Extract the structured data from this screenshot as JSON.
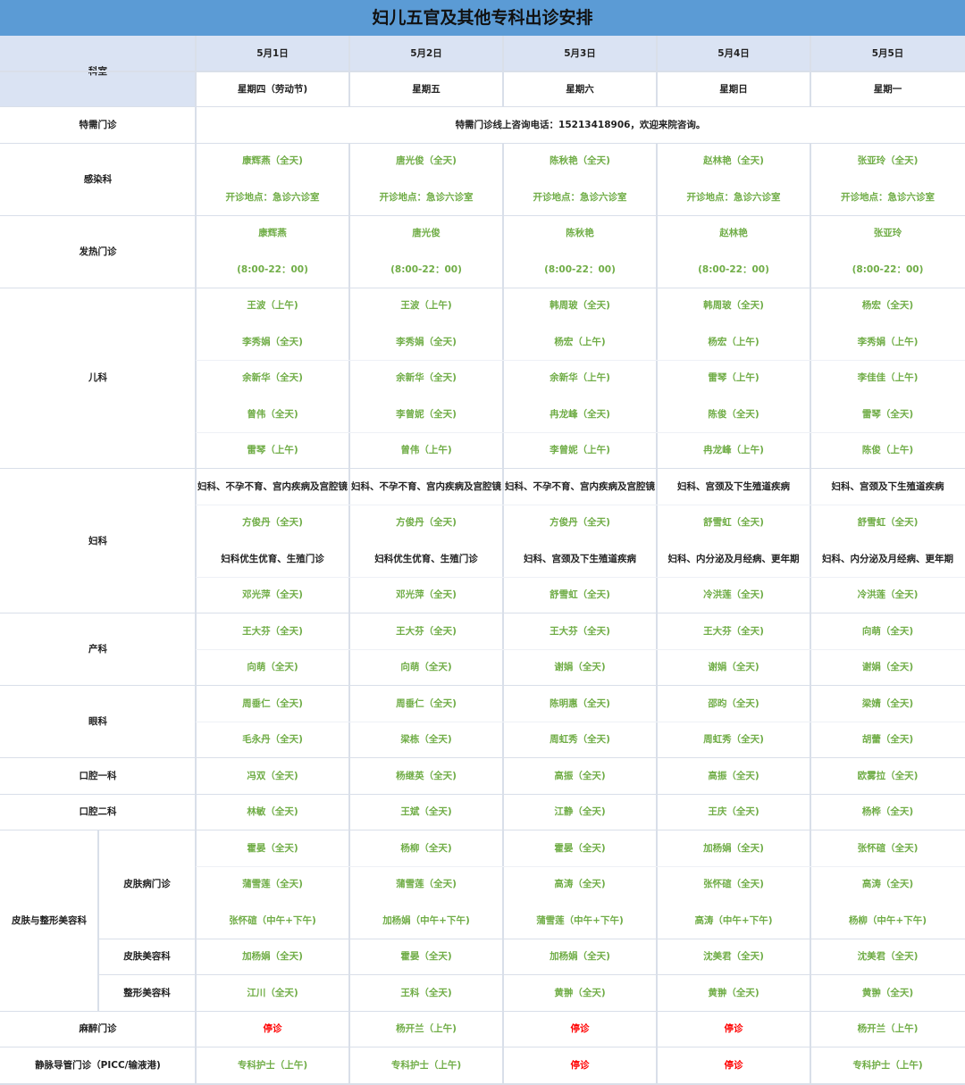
{
  "title": "妇儿五官及其他专科出诊安排",
  "header": {
    "dept_label": "科室",
    "dates": [
      "5月1日",
      "5月2日",
      "5月3日",
      "5月4日",
      "5月5日"
    ],
    "weekdays": [
      "星期四（劳动节)",
      "星期五",
      "星期六",
      "星期日",
      "星期一"
    ]
  },
  "colors": {
    "title_bg": "#5b9bd5",
    "header_bg": "#dae3f3",
    "doctor_text": "#70ad47",
    "suspended_text": "#ff0000"
  },
  "groups": [
    {
      "name": "特需门诊",
      "rows": [
        {
          "span_text": "特需门诊线上咨询电话：15213418906，欢迎来院咨询。"
        }
      ]
    },
    {
      "name": "感染科",
      "rows": [
        {
          "cells": [
            "康辉燕（全天)",
            "唐光俊（全天)",
            "陈秋艳（全天)",
            "赵林艳（全天)",
            "张亚玲（全天)"
          ]
        },
        {
          "cells": [
            "开诊地点：急诊六诊室",
            "开诊地点：急诊六诊室",
            "开诊地点：急诊六诊室",
            "开诊地点：急诊六诊室",
            "开诊地点：急诊六诊室"
          ]
        }
      ]
    },
    {
      "name": "发热门诊",
      "rows": [
        {
          "cells": [
            "康辉燕",
            "唐光俊",
            "陈秋艳",
            "赵林艳",
            "张亚玲"
          ]
        },
        {
          "cells": [
            "(8:00-22：00)",
            "(8:00-22：00)",
            "(8:00-22：00)",
            "(8:00-22：00)",
            "(8:00-22：00)"
          ]
        }
      ]
    },
    {
      "name": "儿科",
      "rows": [
        {
          "cells": [
            "王波（上午)",
            "王波（上午)",
            "韩周玻（全天)",
            "韩周玻（全天)",
            "杨宏（全天)"
          ]
        },
        {
          "cells": [
            "李秀娟（全天)",
            "李秀娟（全天)",
            "杨宏（上午)",
            "杨宏（上午)",
            "李秀娟（上午)"
          ]
        },
        {
          "cells": [
            "余新华（全天)",
            "余新华（全天)",
            "余新华（上午)",
            "雷琴（上午)",
            "李佳佳（上午)"
          ]
        },
        {
          "cells": [
            "曾伟（全天)",
            "李曾妮（全天)",
            "冉龙峰（全天)",
            "陈俊（全天)",
            "雷琴（全天)"
          ]
        },
        {
          "cells": [
            "雷琴（上午)",
            "曾伟（上午)",
            "李曾妮（上午)",
            "冉龙峰（上午)",
            "陈俊（上午)"
          ]
        }
      ]
    },
    {
      "name": "妇科",
      "rows": [
        {
          "type": "gyn",
          "cells": [
            "妇科、不孕不育、宫内疾病及宫腔镜",
            "妇科、不孕不育、宫内疾病及宫腔镜",
            "妇科、不孕不育、宫内疾病及宫腔镜",
            "妇科、宫颈及下生殖道疾病",
            "妇科、宫颈及下生殖道疾病"
          ]
        },
        {
          "cells": [
            "方俊丹（全天)",
            "方俊丹（全天)",
            "方俊丹（全天)",
            "舒雪虹（全天)",
            "舒雪虹（全天)"
          ]
        },
        {
          "type": "gyn",
          "cells": [
            "妇科优生优育、生殖门诊",
            "妇科优生优育、生殖门诊",
            "妇科、宫颈及下生殖道疾病",
            "妇科、内分泌及月经病、更年期",
            "妇科、内分泌及月经病、更年期"
          ]
        },
        {
          "cells": [
            "邓光萍（全天)",
            "邓光萍（全天)",
            "舒雪虹（全天)",
            "冷洪莲（全天)",
            "冷洪莲（全天)"
          ]
        }
      ]
    },
    {
      "name": "产科",
      "rows": [
        {
          "cells": [
            "王大芬（全天)",
            "王大芬（全天)",
            "王大芬（全天)",
            "王大芬（全天)",
            "向萌（全天)"
          ]
        },
        {
          "cells": [
            "向萌（全天)",
            "向萌（全天)",
            "谢娟（全天)",
            "谢娟（全天)",
            "谢娟（全天)"
          ]
        }
      ]
    },
    {
      "name": "眼科",
      "rows": [
        {
          "cells": [
            "周垂仁（全天)",
            "周垂仁（全天)",
            "陈明惠（全天)",
            "邵昀（全天)",
            "梁婧（全天)"
          ]
        },
        {
          "cells": [
            "毛永丹（全天)",
            "梁栋（全天)",
            "周虹秀（全天)",
            "周虹秀（全天)",
            "胡蕾（全天)"
          ]
        }
      ]
    },
    {
      "name": "口腔一科",
      "rows": [
        {
          "cells": [
            "冯双（全天)",
            "杨继英（全天)",
            "高振（全天)",
            "高振（全天)",
            "欧雾拉（全天)"
          ]
        }
      ]
    },
    {
      "name": "口腔二科",
      "rows": [
        {
          "cells": [
            "林敏（全天)",
            "王斌（全天)",
            "江静（全天)",
            "王庆（全天)",
            "杨桦（全天)"
          ]
        }
      ]
    },
    {
      "name": "皮肤与整形美容科",
      "subgroups": [
        {
          "name": "皮肤病门诊",
          "rows": [
            {
              "cells": [
                "霍晏（全天)",
                "杨柳（全天)",
                "霍晏（全天)",
                "加杨娟（全天)",
                "张怀碹（全天)"
              ]
            },
            {
              "cells": [
                "蒲雪莲（全天)",
                "蒲雪莲（全天)",
                "高涛（全天)",
                "张怀碹（全天)",
                "高涛（全天)"
              ]
            },
            {
              "cells": [
                "张怀碹（中午+下午)",
                "加杨娟（中午+下午)",
                "蒲雪莲（中午+下午)",
                "高涛（中午+下午)",
                "杨柳（中午+下午)"
              ]
            }
          ]
        },
        {
          "name": "皮肤美容科",
          "rows": [
            {
              "cells": [
                "加杨娟（全天)",
                "霍晏（全天)",
                "加杨娟（全天)",
                "沈美君（全天)",
                "沈美君（全天)"
              ]
            }
          ]
        },
        {
          "name": "整形美容科",
          "rows": [
            {
              "cells": [
                "江川（全天)",
                "王科（全天)",
                "黄翀（全天)",
                "黄翀（全天)",
                "黄翀（全天)"
              ]
            }
          ]
        }
      ]
    },
    {
      "name": "麻醉门诊",
      "rows": [
        {
          "cells": [
            "停诊",
            "杨开兰（上午)",
            "停诊",
            "停诊",
            "杨开兰（上午)"
          ]
        }
      ]
    },
    {
      "name": "静脉导管门诊（PICC/输液港)",
      "rows": [
        {
          "cells": [
            "专科护士（上午)",
            "专科护士（上午)",
            "停诊",
            "停诊",
            "专科护士（上午)"
          ]
        }
      ]
    }
  ],
  "suspended_label": "停诊"
}
